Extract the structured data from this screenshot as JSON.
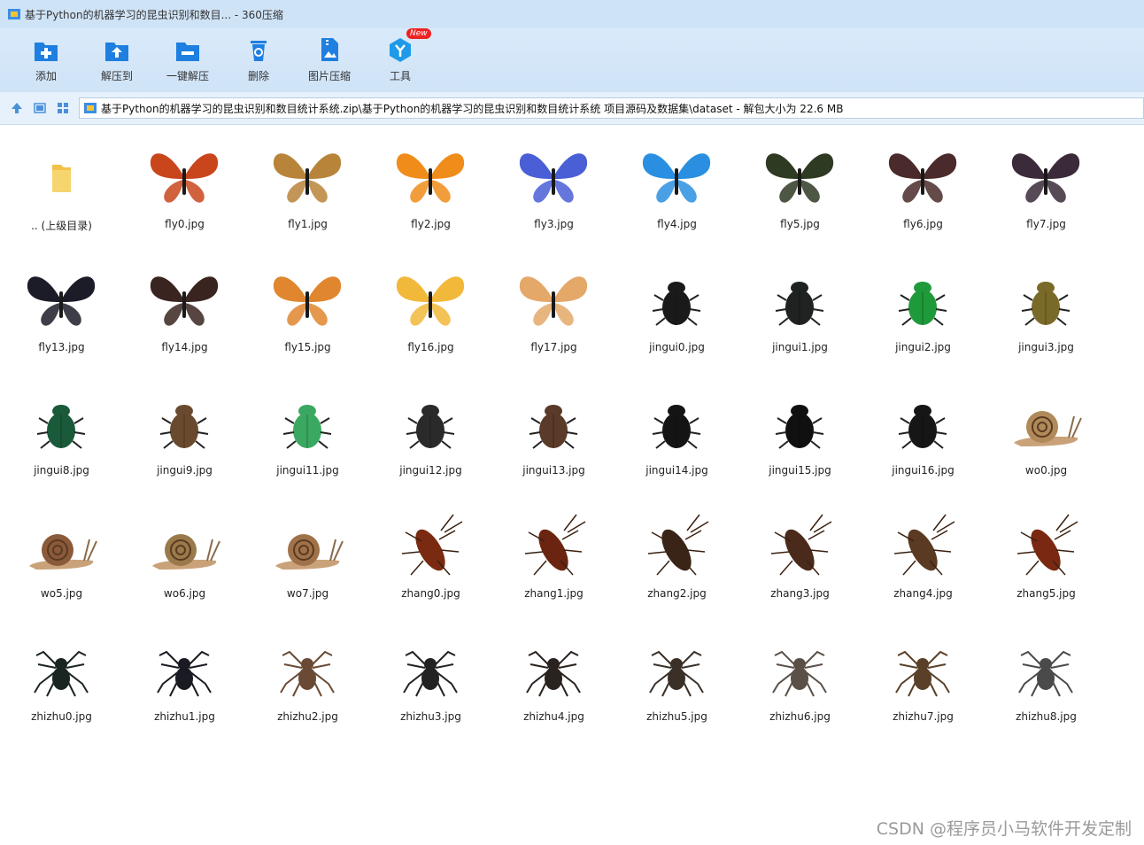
{
  "window": {
    "title": "基于Python的机器学习的昆虫识别和数目... - 360压缩"
  },
  "toolbar": {
    "items": [
      {
        "label": "添加",
        "icon": "add-icon"
      },
      {
        "label": "解压到",
        "icon": "extract-to-icon"
      },
      {
        "label": "一键解压",
        "icon": "one-click-extract-icon"
      },
      {
        "label": "删除",
        "icon": "delete-icon"
      },
      {
        "label": "图片压缩",
        "icon": "image-compress-icon"
      },
      {
        "label": "工具",
        "icon": "tools-icon",
        "badge": "New"
      }
    ]
  },
  "address": {
    "path": "基于Python的机器学习的昆虫识别和数目统计系统.zip\\基于Python的机器学习的昆虫识别和数目统计系统 项目源码及数据集\\dataset - 解包大小为 22.6 MB"
  },
  "files": [
    {
      "name": ".. (上级目录)",
      "kind": "folder"
    },
    {
      "name": "fly0.jpg",
      "kind": "butterfly",
      "color": "#c9461c"
    },
    {
      "name": "fly1.jpg",
      "kind": "butterfly",
      "color": "#b8843a"
    },
    {
      "name": "fly2.jpg",
      "kind": "butterfly",
      "color": "#f08c1a"
    },
    {
      "name": "fly3.jpg",
      "kind": "butterfly",
      "color": "#4a5fd6"
    },
    {
      "name": "fly4.jpg",
      "kind": "butterfly",
      "color": "#2a8fe0"
    },
    {
      "name": "fly5.jpg",
      "kind": "butterfly",
      "color": "#2e3a22"
    },
    {
      "name": "fly6.jpg",
      "kind": "butterfly",
      "color": "#4a2a2a"
    },
    {
      "name": "fly7.jpg",
      "kind": "butterfly",
      "color": "#3a2a3a"
    },
    {
      "name": "fly13.jpg",
      "kind": "butterfly",
      "color": "#1c1c28"
    },
    {
      "name": "fly14.jpg",
      "kind": "butterfly",
      "color": "#3a2420"
    },
    {
      "name": "fly15.jpg",
      "kind": "butterfly",
      "color": "#e0862e"
    },
    {
      "name": "fly16.jpg",
      "kind": "butterfly",
      "color": "#f2b83a"
    },
    {
      "name": "fly17.jpg",
      "kind": "butterfly",
      "color": "#e4a868"
    },
    {
      "name": "jingui0.jpg",
      "kind": "beetle",
      "color": "#1a1a1a"
    },
    {
      "name": "jingui1.jpg",
      "kind": "beetle",
      "color": "#1e2220"
    },
    {
      "name": "jingui2.jpg",
      "kind": "beetle",
      "color": "#1f9a3a"
    },
    {
      "name": "jingui3.jpg",
      "kind": "beetle",
      "color": "#7a6a2a"
    },
    {
      "name": "jingui8.jpg",
      "kind": "beetle",
      "color": "#1a5a3a"
    },
    {
      "name": "jingui9.jpg",
      "kind": "beetle",
      "color": "#6a4a2e"
    },
    {
      "name": "jingui11.jpg",
      "kind": "beetle",
      "color": "#3aa860"
    },
    {
      "name": "jingui12.jpg",
      "kind": "beetle",
      "color": "#2a2a2a"
    },
    {
      "name": "jingui13.jpg",
      "kind": "beetle",
      "color": "#5a3a28"
    },
    {
      "name": "jingui14.jpg",
      "kind": "beetle",
      "color": "#141414"
    },
    {
      "name": "jingui15.jpg",
      "kind": "beetle",
      "color": "#101010"
    },
    {
      "name": "jingui16.jpg",
      "kind": "beetle",
      "color": "#161616"
    },
    {
      "name": "wo0.jpg",
      "kind": "snail",
      "color": "#b08a5a"
    },
    {
      "name": "wo5.jpg",
      "kind": "snail",
      "color": "#8a5a3a"
    },
    {
      "name": "wo6.jpg",
      "kind": "snail",
      "color": "#9a7a4a"
    },
    {
      "name": "wo7.jpg",
      "kind": "snail",
      "color": "#a0724a"
    },
    {
      "name": "zhang0.jpg",
      "kind": "cockroach",
      "color": "#7a2a10"
    },
    {
      "name": "zhang1.jpg",
      "kind": "cockroach",
      "color": "#6a2410"
    },
    {
      "name": "zhang2.jpg",
      "kind": "cockroach",
      "color": "#3a2418"
    },
    {
      "name": "zhang3.jpg",
      "kind": "cockroach",
      "color": "#4a2a1a"
    },
    {
      "name": "zhang4.jpg",
      "kind": "cockroach",
      "color": "#5a3a22"
    },
    {
      "name": "zhang5.jpg",
      "kind": "cockroach",
      "color": "#7a2812"
    },
    {
      "name": "zhizhu0.jpg",
      "kind": "spider",
      "color": "#1a2420"
    },
    {
      "name": "zhizhu1.jpg",
      "kind": "spider",
      "color": "#1a1a22"
    },
    {
      "name": "zhizhu2.jpg",
      "kind": "spider",
      "color": "#6a4a34"
    },
    {
      "name": "zhizhu3.jpg",
      "kind": "spider",
      "color": "#222222"
    },
    {
      "name": "zhizhu4.jpg",
      "kind": "spider",
      "color": "#2a221e"
    },
    {
      "name": "zhizhu5.jpg",
      "kind": "spider",
      "color": "#3a3028"
    },
    {
      "name": "zhizhu6.jpg",
      "kind": "spider",
      "color": "#5a5048"
    },
    {
      "name": "zhizhu7.jpg",
      "kind": "spider",
      "color": "#5a4028"
    },
    {
      "name": "zhizhu8.jpg",
      "kind": "spider",
      "color": "#4a4a4a"
    }
  ],
  "watermark": "CSDN @程序员小马软件开发定制"
}
